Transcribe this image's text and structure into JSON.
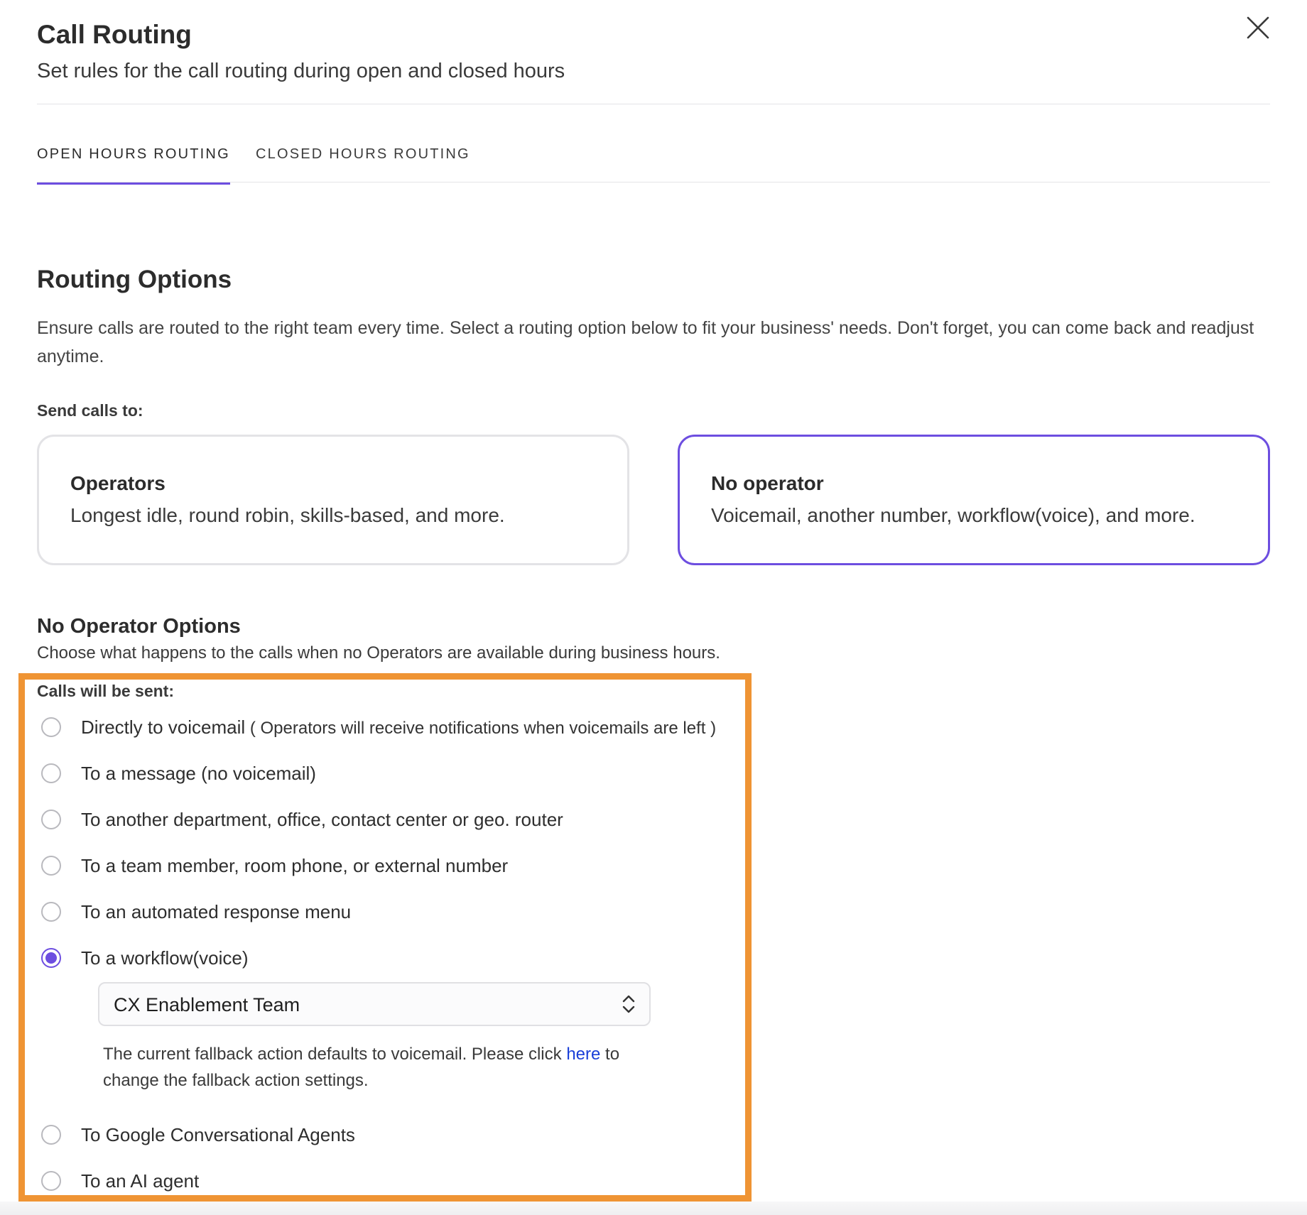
{
  "header": {
    "title": "Call Routing",
    "subtitle": "Set rules for the call routing during open and closed hours"
  },
  "tabs": [
    {
      "label": "OPEN HOURS ROUTING",
      "active": true
    },
    {
      "label": "CLOSED HOURS ROUTING",
      "active": false
    }
  ],
  "routing": {
    "title": "Routing Options",
    "description": "Ensure calls are routed to the right team every time. Select a routing option below to fit your business' needs. Don't forget, you can come back and readjust anytime.",
    "send_calls_label": "Send calls to:",
    "cards": [
      {
        "title": "Operators",
        "description": "Longest idle, round robin, skills-based, and more.",
        "selected": false
      },
      {
        "title": "No operator",
        "description": "Voicemail, another number, workflow(voice), and more.",
        "selected": true
      }
    ]
  },
  "no_operator": {
    "title": "No Operator Options",
    "description": "Choose what happens to the calls when no Operators are available during business hours.",
    "calls_sent_label": "Calls will be sent:",
    "options": [
      {
        "label": "Directly to voicemail",
        "note": " ( Operators will receive notifications when voicemails are left )",
        "checked": false
      },
      {
        "label": "To a message (no voicemail)",
        "checked": false
      },
      {
        "label": "To another department, office, contact center or geo. router",
        "checked": false
      },
      {
        "label": "To a team member, room phone, or external number",
        "checked": false
      },
      {
        "label": "To an automated response menu",
        "checked": false
      },
      {
        "label": "To a workflow(voice)",
        "checked": true
      },
      {
        "label": "To Google Conversational Agents",
        "checked": false
      },
      {
        "label": "To an AI agent",
        "checked": false
      }
    ],
    "workflow_select": {
      "value": "CX Enablement Team"
    },
    "fallback": {
      "before": "The current fallback action defaults to voicemail. Please click ",
      "link": "here",
      "after": " to change the fallback action settings."
    }
  },
  "colors": {
    "accent": "#6d4ee0",
    "highlight": "#ef9434",
    "link": "#1a3fd8"
  }
}
